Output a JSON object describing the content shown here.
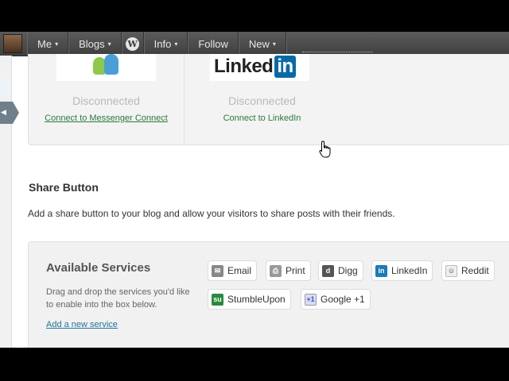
{
  "adminbar": {
    "items": [
      {
        "label": "Me",
        "caret": "▾"
      },
      {
        "label": "Blogs",
        "caret": "▾"
      },
      {
        "label": "Info",
        "caret": "▾"
      },
      {
        "label": "Follow",
        "caret": ""
      },
      {
        "label": "New",
        "caret": "▾"
      }
    ],
    "wp_glyph": "W"
  },
  "connections": [
    {
      "service": "Messenger",
      "status": "Disconnected",
      "link": "Connect to Messenger Connect"
    },
    {
      "service": "LinkedIn",
      "logo_text": "Linked",
      "logo_badge": "in",
      "status": "Disconnected",
      "link": "Connect to LinkedIn"
    }
  ],
  "share": {
    "title": "Share Button",
    "description": "Add a share button to your blog and allow your visitors to share posts with their friends."
  },
  "available_services": {
    "title": "Available Services",
    "description": "Drag and drop the services you'd like to enable into the box below.",
    "add_link": "Add a new service",
    "services": [
      {
        "label": "Email",
        "icon": "email-icon",
        "glyph": "✉"
      },
      {
        "label": "Print",
        "icon": "print-icon",
        "glyph": "⎙"
      },
      {
        "label": "Digg",
        "icon": "digg-icon",
        "glyph": "d"
      },
      {
        "label": "LinkedIn",
        "icon": "linkedin-icon",
        "glyph": "in"
      },
      {
        "label": "Reddit",
        "icon": "reddit-icon",
        "glyph": "☺"
      },
      {
        "label": "StumbleUpon",
        "icon": "stumbleupon-icon",
        "glyph": "su"
      },
      {
        "label": "Google +1",
        "icon": "google-plus-icon",
        "glyph": "+1"
      }
    ]
  },
  "colors": {
    "link": "#21759b",
    "adminbar": "#464646",
    "panel": "#f1f1f1"
  }
}
